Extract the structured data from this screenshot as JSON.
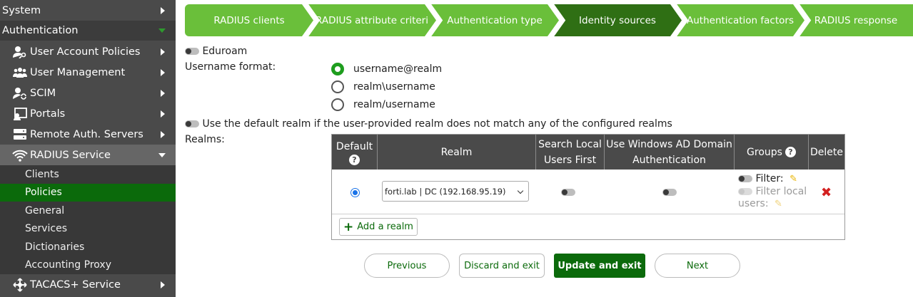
{
  "sidebar": {
    "system_label": "System",
    "authentication_label": "Authentication",
    "items": [
      {
        "label": "User Account Policies",
        "icon": "user-key-icon"
      },
      {
        "label": "User Management",
        "icon": "users-icon"
      },
      {
        "label": "SCIM",
        "icon": "user-sync-icon"
      },
      {
        "label": "Portals",
        "icon": "portal-icon"
      },
      {
        "label": "Remote Auth. Servers",
        "icon": "server-icon"
      },
      {
        "label": "RADIUS Service",
        "icon": "radius-wifi-icon"
      }
    ],
    "radius_subitems": [
      "Clients",
      "Policies",
      "General",
      "Services",
      "Dictionaries",
      "Accounting Proxy"
    ],
    "active_subitem": "Policies",
    "tacacs_label": "TACACS+ Service"
  },
  "wizard": {
    "steps": [
      "RADIUS clients",
      "RADIUS attribute criteri",
      "Authentication type",
      "Identity sources",
      "Authentication factors",
      "RADIUS response"
    ],
    "active_step": "Identity sources",
    "colors": {
      "step": "#6abf3a",
      "active": "#2f6f14",
      "divider": "#ffffff"
    }
  },
  "form": {
    "eduroam_label": "Eduroam",
    "username_format_label": "Username format:",
    "username_formats": [
      "username@realm",
      "realm\\username",
      "realm/username"
    ],
    "selected_format": "username@realm",
    "default_realm_label": "Use the default realm if the user-provided realm does not match any of the configured realms",
    "realms_label": "Realms:"
  },
  "realms_table": {
    "headers": {
      "default": "Default",
      "realm": "Realm",
      "search_local_1": "Search Local",
      "search_local_2": "Users First",
      "windows_ad_1": "Use Windows AD Domain",
      "windows_ad_2": "Authentication",
      "groups": "Groups",
      "delete": "Delete"
    },
    "row": {
      "realm_value": "forti.lab | DC (192.168.95.19)",
      "filter_label": "Filter:",
      "filter_local_label_1": "Filter local",
      "filter_local_label_2": "users:"
    },
    "add_realm_label": "Add a realm"
  },
  "buttons": {
    "previous": "Previous",
    "discard": "Discard and exit",
    "update": "Update and exit",
    "next": "Next"
  },
  "colors": {
    "sidebar_bg": "#4a4a4a",
    "active_green": "#0b6a0b",
    "radio_green": "#1e9d1e",
    "delete_red": "#d32020"
  }
}
